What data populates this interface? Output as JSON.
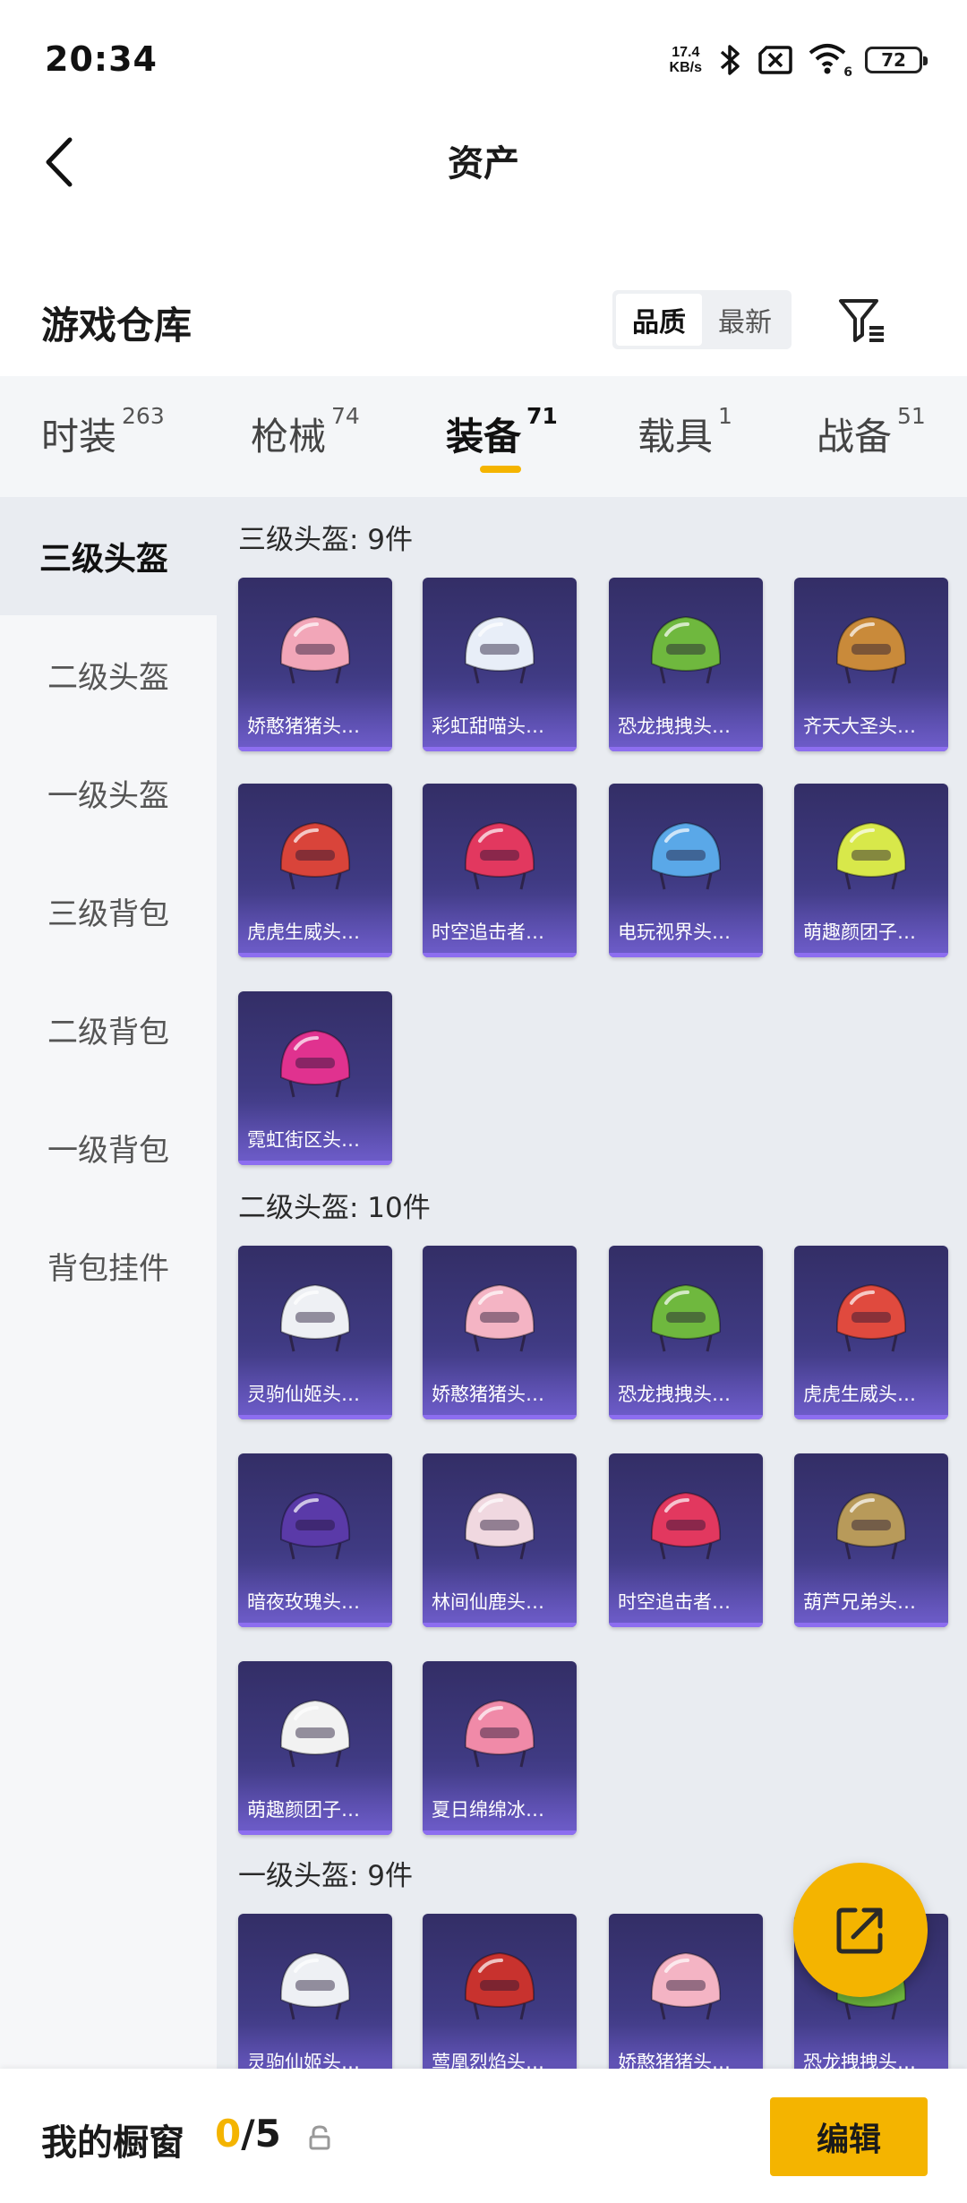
{
  "status_bar": {
    "time": "20:34",
    "net_speed_value": "17.4",
    "net_speed_unit": "KB/s",
    "wifi_badge": "6",
    "battery": "72"
  },
  "header": {
    "title": "资产"
  },
  "warehouse": {
    "title": "游戏仓库",
    "sort_options": [
      "品质",
      "最新"
    ],
    "active_sort": "品质"
  },
  "tabs": [
    {
      "label": "时装",
      "count": "263"
    },
    {
      "label": "枪械",
      "count": "74"
    },
    {
      "label": "装备",
      "count": "71",
      "active": true
    },
    {
      "label": "载具",
      "count": "1"
    },
    {
      "label": "战备",
      "count": "51"
    }
  ],
  "sidebar": {
    "items": [
      "三级头盔",
      "二级头盔",
      "一级头盔",
      "三级背包",
      "二级背包",
      "一级背包",
      "背包挂件"
    ],
    "active": "三级头盔"
  },
  "sections": [
    {
      "label": "三级头盔: 9件",
      "items": [
        {
          "name": "娇憨猪猪头…",
          "icon": "pig-helmet-icon",
          "color": "#f2a6b8"
        },
        {
          "name": "彩虹甜喵头…",
          "icon": "cat-helmet-icon",
          "color": "#e8eef8"
        },
        {
          "name": "恐龙拽拽头…",
          "icon": "frog-helmet-icon",
          "color": "#6fb83e"
        },
        {
          "name": "齐天大圣头…",
          "icon": "monkey-king-helmet-icon",
          "color": "#c98a3a"
        },
        {
          "name": "虎虎生威头…",
          "icon": "tiger-helmet-icon",
          "color": "#d9443a"
        },
        {
          "name": "时空追击者…",
          "icon": "mecha-helmet-icon",
          "color": "#e2385f"
        },
        {
          "name": "电玩视界头…",
          "icon": "game-helmet-icon",
          "color": "#5aa8e8"
        },
        {
          "name": "萌趣颜团子…",
          "icon": "dango-helmet-icon",
          "color": "#d8e84a"
        },
        {
          "name": "霓虹街区头…",
          "icon": "neon-helmet-icon",
          "color": "#e0328f"
        }
      ]
    },
    {
      "label": "二级头盔: 10件",
      "items": [
        {
          "name": "灵驹仙姬头…",
          "icon": "horse-helmet-icon",
          "color": "#eef0f4"
        },
        {
          "name": "娇憨猪猪头…",
          "icon": "pig-helmet-icon",
          "color": "#f4b4c4"
        },
        {
          "name": "恐龙拽拽头…",
          "icon": "frog-helmet-icon",
          "color": "#6fb83e"
        },
        {
          "name": "虎虎生威头…",
          "icon": "tiger-helmet-icon",
          "color": "#e04a3e"
        },
        {
          "name": "暗夜玫瑰头…",
          "icon": "rose-helmet-icon",
          "color": "#5a3aa8"
        },
        {
          "name": "林间仙鹿头…",
          "icon": "deer-helmet-icon",
          "color": "#f0d8e0"
        },
        {
          "name": "时空追击者…",
          "icon": "mecha-helmet-icon",
          "color": "#e2385f"
        },
        {
          "name": "葫芦兄弟头…",
          "icon": "gourd-helmet-icon",
          "color": "#b89a5a"
        },
        {
          "name": "萌趣颜团子…",
          "icon": "dango-helmet-icon",
          "color": "#f2f2f2"
        },
        {
          "name": "夏日绵绵冰…",
          "icon": "icecream-helmet-icon",
          "color": "#f08aa8"
        }
      ]
    },
    {
      "label": "一级头盔: 9件",
      "items": [
        {
          "name": "灵驹仙姬头…",
          "icon": "horse-helmet-icon",
          "color": "#eef0f4"
        },
        {
          "name": "莺凰烈焰头…",
          "icon": "flame-helmet-icon",
          "color": "#c8322e"
        },
        {
          "name": "娇憨猪猪头…",
          "icon": "pig-helmet-icon",
          "color": "#f4b4c4"
        },
        {
          "name": "恐龙拽拽头…",
          "icon": "frog-helmet-icon",
          "color": "#6fb83e"
        }
      ]
    }
  ],
  "bottom_bar": {
    "title": "我的橱窗",
    "current": "0",
    "total": "/5",
    "edit_label": "编辑"
  },
  "colors": {
    "accent": "#f4b400",
    "card_bg": "#3f3a82"
  }
}
